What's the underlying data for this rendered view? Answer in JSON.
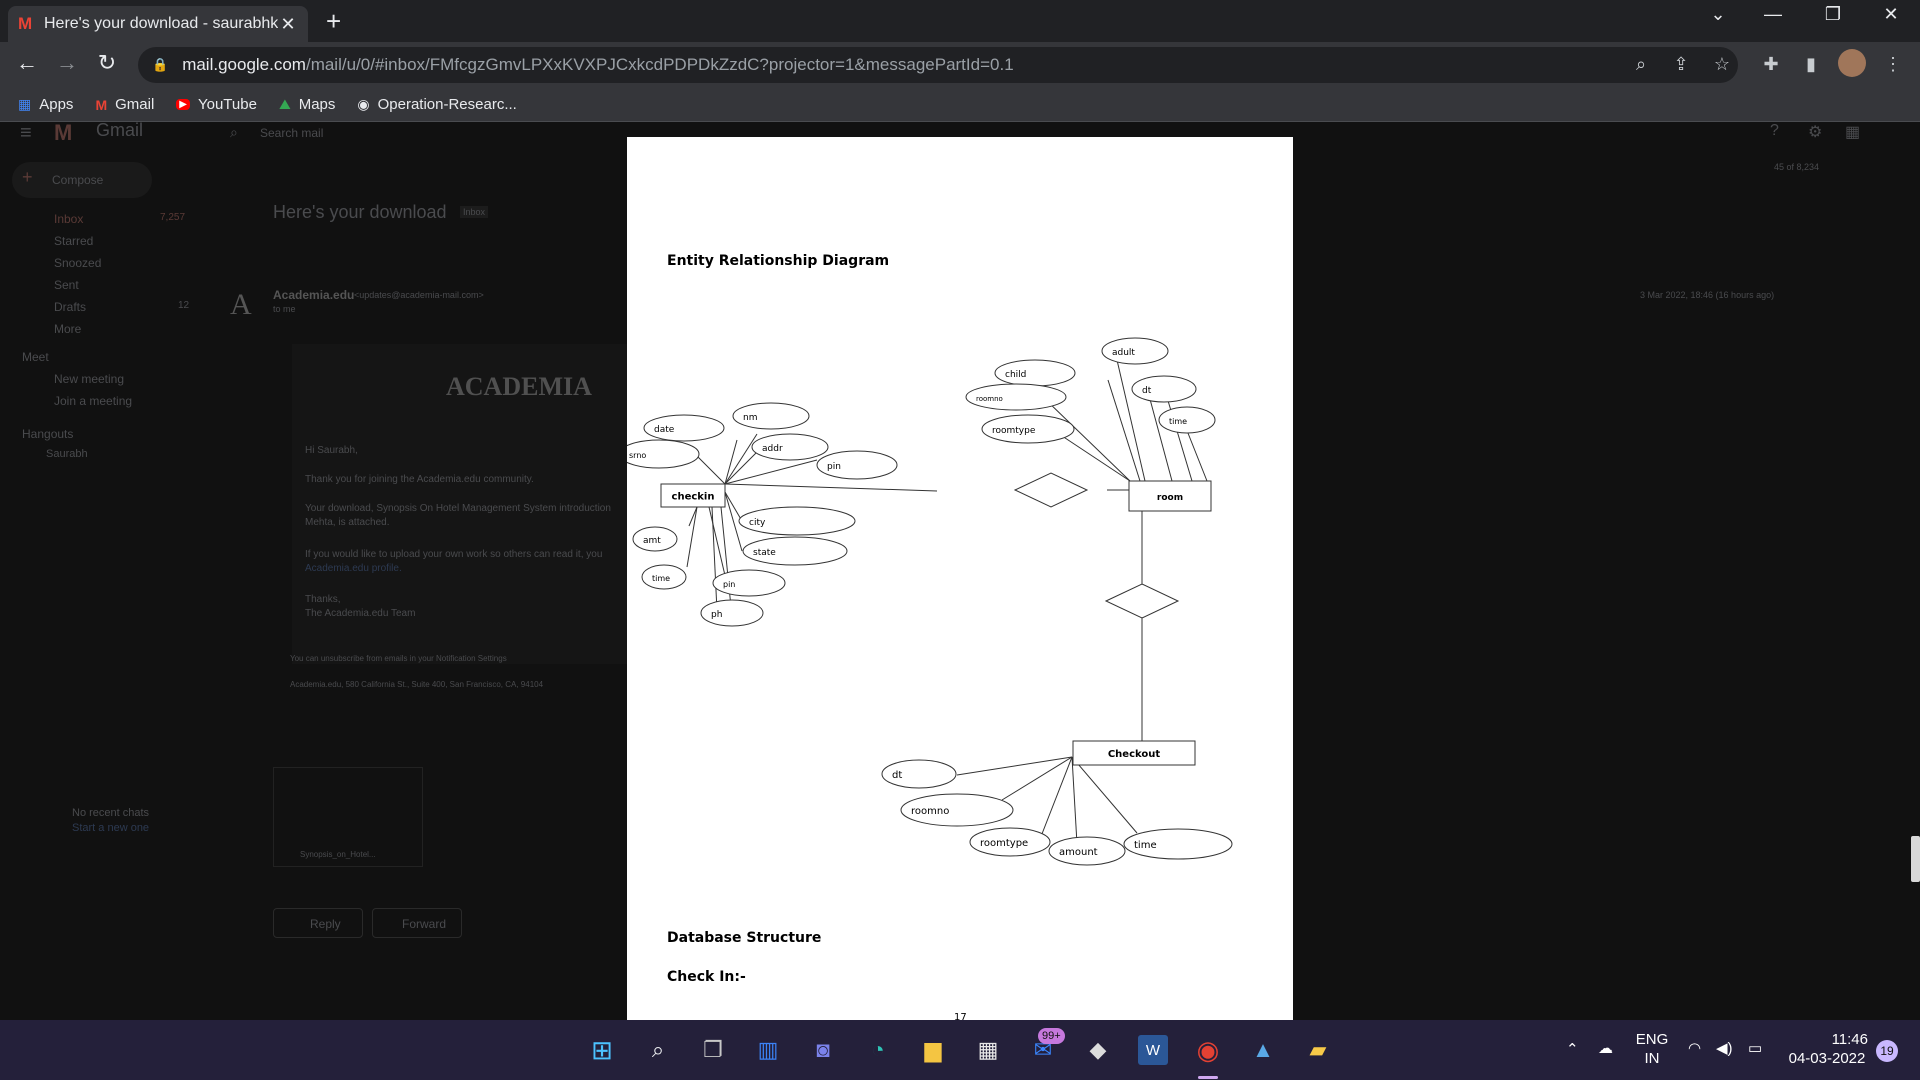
{
  "browser": {
    "tab_title": "Here's your download - saurabhk",
    "url_host": "mail.google.com",
    "url_path": "/mail/u/0/#inbox/FMfcgzGmvLPXxKVXPJCxkcdPDPDkZzdC?projector=1&messagePartId=0.1"
  },
  "bookmarks": [
    {
      "label": "Apps",
      "icon": "apps-grid-icon",
      "color": "#4285f4"
    },
    {
      "label": "Gmail",
      "icon": "gmail-icon",
      "color": "#ea4335"
    },
    {
      "label": "YouTube",
      "icon": "youtube-icon",
      "color": "#ff0000"
    },
    {
      "label": "Maps",
      "icon": "maps-icon",
      "color": "#34a853"
    },
    {
      "label": "Operation-Researc...",
      "icon": "globe-icon",
      "color": "#e8eaed"
    }
  ],
  "gmail": {
    "brand": "Gmail",
    "search_placeholder": "Search mail",
    "compose": "Compose",
    "nav": [
      {
        "label": "Inbox",
        "count": "7,257"
      },
      {
        "label": "Starred",
        "count": ""
      },
      {
        "label": "Snoozed",
        "count": ""
      },
      {
        "label": "Sent",
        "count": ""
      },
      {
        "label": "Drafts",
        "count": "12"
      },
      {
        "label": "More",
        "count": ""
      }
    ],
    "meet_header": "Meet",
    "meet_items": [
      "New meeting",
      "Join a meeting"
    ],
    "hangouts_header": "Hangouts",
    "hangouts_user": "Saurabh",
    "no_chats": "No recent chats",
    "start_new": "Start a new one",
    "pager": "45 of 8,234",
    "subject": "Here's your download",
    "subject_badge": "Inbox",
    "sender": "Academia.edu",
    "sender_email": "<updates@academia-mail.com>",
    "to_me": "to me",
    "date": "3 Mar 2022, 18:46 (16 hours ago)",
    "academia_logo": "ACADEMIA",
    "body_lines": [
      "Hi Saurabh,",
      "Thank you for joining the Academia.edu community.",
      "Your download, Synopsis On Hotel Management System introduction",
      "Mehta, is attached.",
      "If you would like to upload your own work so others can read it, you",
      "Academia.edu profile.",
      "Thanks,",
      "The Academia.edu Team"
    ],
    "footer_lines": [
      "You can unsubscribe from emails in your Notification Settings",
      "Academia.edu, 580 California St., Suite 400, San Francisco, CA, 94104"
    ],
    "attachment_name": "Synopsis_on_Hotel...",
    "reply": "Reply",
    "forward": "Forward"
  },
  "document": {
    "heading1": "Entity Relationship Diagram",
    "heading2": "Database Structure",
    "heading3": "Check In:-",
    "page_number": "17",
    "entities": {
      "checkin": "checkin",
      "room": "room",
      "checkout": "Checkout"
    },
    "checkin_attrs": [
      "nm",
      "date",
      "srno",
      "addr",
      "pin",
      "city",
      "state",
      "amt",
      "time",
      "pin",
      "ph"
    ],
    "room_attrs": [
      "adult",
      "child",
      "roomno",
      "dt",
      "time",
      "roomtype"
    ],
    "checkout_attrs": [
      "dt",
      "roomno",
      "roomtype",
      "amount",
      "time"
    ]
  },
  "taskbar": {
    "mail_badge": "99+",
    "lang1": "ENG",
    "lang2": "IN",
    "time": "11:46",
    "date": "04-03-2022",
    "notif_count": "19"
  }
}
